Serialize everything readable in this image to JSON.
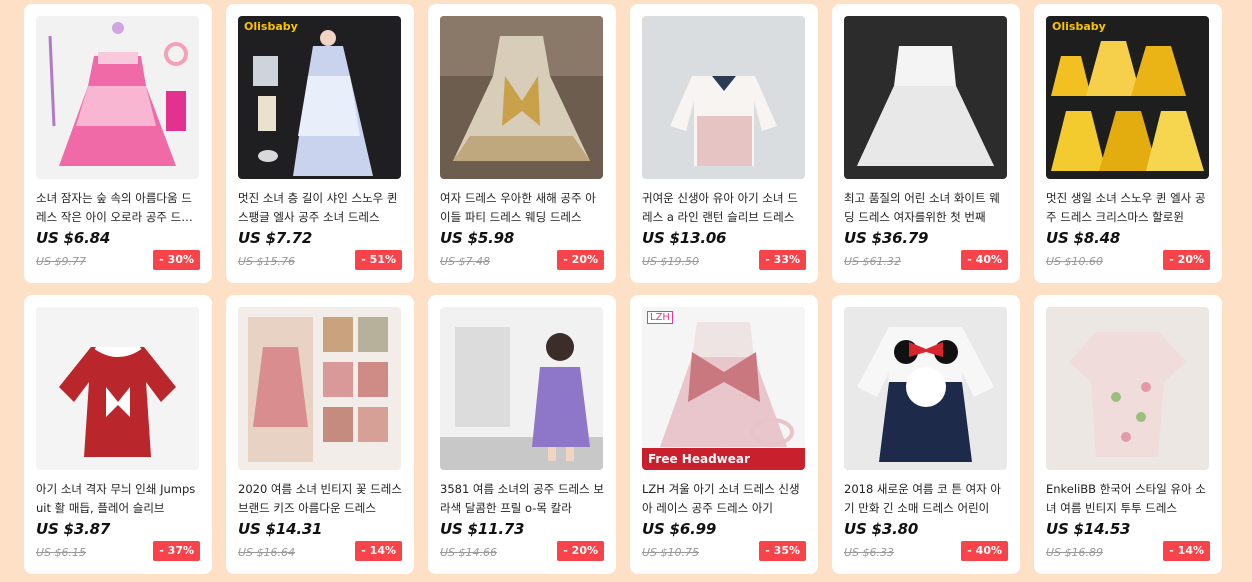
{
  "products": [
    {
      "title": "소녀 잠자는 숲 속의 아름다움 드레스 작은 아이 오로라 공주 드레스",
      "price": "US $6.84",
      "original_price": "US $9.77",
      "discount": "- 30%",
      "brand_label": "",
      "banner_label": "",
      "image_icon": "pink-princess-dress-image"
    },
    {
      "title": "멋진 소녀 층 길이 샤인 스노우 퀸 스팽글 엘사 공주 소녀 드레스",
      "price": "US $7.72",
      "original_price": "US $15.76",
      "discount": "- 51%",
      "brand_label": "Olisbaby",
      "banner_label": "",
      "image_icon": "elsa-dress-image"
    },
    {
      "title": "여자 드레스 우아한 새해 공주 아이들 파티 드레스 웨딩 드레스",
      "price": "US $5.98",
      "original_price": "US $7.48",
      "discount": "- 20%",
      "brand_label": "",
      "banner_label": "",
      "image_icon": "gold-bow-dress-image"
    },
    {
      "title": "귀여운 신생아 유아 아기 소녀 드레스 a 라인 랜턴 슬리브 드레스",
      "price": "US $13.06",
      "original_price": "US $19.50",
      "discount": "- 33%",
      "brand_label": "",
      "banner_label": "",
      "image_icon": "tweed-baby-dress-image"
    },
    {
      "title": "최고 품질의 어린 소녀 화이트 웨딩 드레스 여자를위한 첫 번째",
      "price": "US $36.79",
      "original_price": "US $61.32",
      "discount": "- 40%",
      "brand_label": "",
      "banner_label": "",
      "image_icon": "white-tutu-dress-image"
    },
    {
      "title": "멋진 생일 소녀 스노우 퀸 엘사 공주 드레스 크리스마스 할로윈",
      "price": "US $8.48",
      "original_price": "US $10.60",
      "discount": "- 20%",
      "brand_label": "Olisbaby",
      "banner_label": "",
      "image_icon": "yellow-belle-dresses-image"
    },
    {
      "title": "아기 소녀 격자 무늬 인쇄 Jumpsuit 활 매듭, 플레어 슬리브",
      "price": "US $3.87",
      "original_price": "US $6.15",
      "discount": "- 37%",
      "brand_label": "",
      "banner_label": "",
      "image_icon": "plaid-romper-image"
    },
    {
      "title": "2020 여름 소녀 빈티지 꽃 드레스 브랜드 키즈 아름다운 드레스",
      "price": "US $14.31",
      "original_price": "US $16.64",
      "discount": "- 14%",
      "brand_label": "",
      "banner_label": "",
      "image_icon": "floral-set-image"
    },
    {
      "title": "3581 여름 소녀의 공주 드레스 보라색 달콤한 프릴 o-목 칼라",
      "price": "US $11.73",
      "original_price": "US $14.66",
      "discount": "- 20%",
      "brand_label": "",
      "banner_label": "",
      "image_icon": "purple-dress-girl-image"
    },
    {
      "title": "LZH 겨울 아기 소녀 드레스 신생아 레이스 공주 드레스 아기",
      "price": "US $6.99",
      "original_price": "US $10.75",
      "discount": "- 35%",
      "brand_label": "LZH",
      "banner_label": "Free Headwear",
      "image_icon": "pink-lace-dress-image"
    },
    {
      "title": "2018 새로운 여름 코 튼 여자 아기 만화 긴 소매 드레스 어린이",
      "price": "US $3.80",
      "original_price": "US $6.33",
      "discount": "- 40%",
      "brand_label": "",
      "banner_label": "",
      "image_icon": "minnie-dress-image"
    },
    {
      "title": "EnkeliBB 한국어 스타일 유아 소녀 여름 빈티지 투투 드레스",
      "price": "US $14.53",
      "original_price": "US $16.89",
      "discount": "- 14%",
      "brand_label": "",
      "banner_label": "",
      "image_icon": "floral-puff-dress-image"
    }
  ],
  "colors": {
    "background": "#fde0c6",
    "card": "#ffffff",
    "discount_badge": "#f8434a",
    "price": "#111111",
    "original_price": "#999999"
  }
}
